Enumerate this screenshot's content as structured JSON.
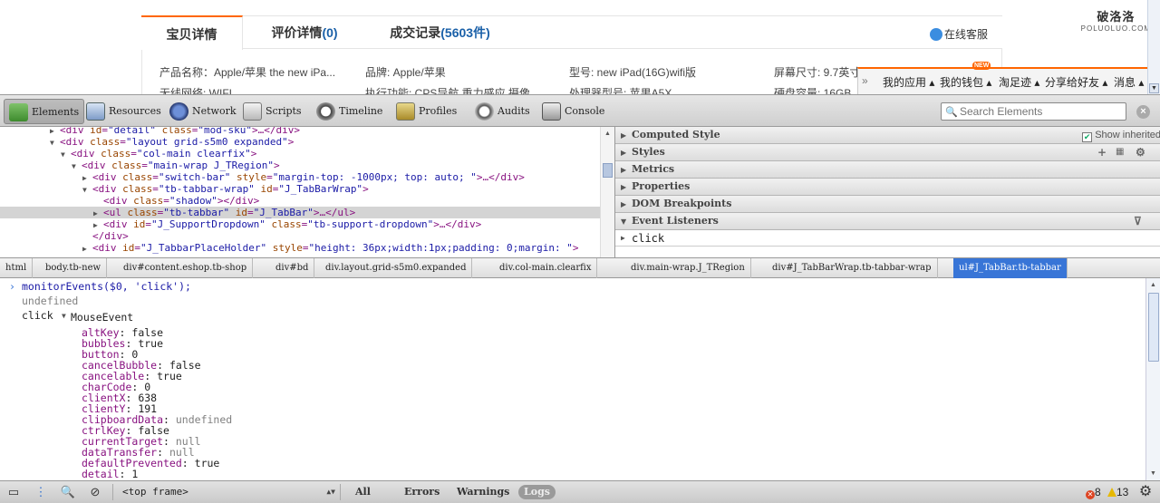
{
  "page": {
    "tabs": [
      {
        "label": "宝贝详情",
        "count": ""
      },
      {
        "label": "评价详情",
        "count": "(0)"
      },
      {
        "label": "成交记录",
        "count": "(5603件)"
      }
    ],
    "service": "在线客服",
    "attrs_row1": [
      "产品名称：Apple/苹果 the new iPa...",
      "品牌: Apple/苹果",
      "型号: new iPad(16G)wifi版",
      "屏幕尺寸: 9.7英寸"
    ],
    "attrs_row2": [
      "无线网络: WIFI",
      "执行功能: CPS导航 重力感应 摄像",
      "处理器型号: 苹果A5X",
      "硬盘容量: 16GB"
    ],
    "logo": {
      "line1": "破洛洛",
      "line2": "POLUOLUO.COM"
    },
    "toolbar_float": [
      "我的应用",
      "我的钱包",
      "淘足迹",
      "分享给好友",
      "消息"
    ],
    "new_badge": "NEW"
  },
  "devtools": {
    "toolbar": [
      "Elements",
      "Resources",
      "Network",
      "Scripts",
      "Timeline",
      "Profiles",
      "Audits",
      "Console"
    ],
    "search_placeholder": "Search Elements",
    "dom_lines": [
      {
        "depth": 4,
        "tri": "▶",
        "html": "<div id=\"detail\" class=\"mod-sku\">…</div>"
      },
      {
        "depth": 4,
        "tri": "▼",
        "html": "<div class=\"layout grid-s5m0  expanded\">"
      },
      {
        "depth": 5,
        "tri": "▼",
        "html": "<div class=\"col-main clearfix\">"
      },
      {
        "depth": 6,
        "tri": "▼",
        "html": "<div class=\"main-wrap J_TRegion\">"
      },
      {
        "depth": 7,
        "tri": "▶",
        "html": "<div class=\"switch-bar\" style=\"margin-top: -1000px; top: auto; \">…</div>"
      },
      {
        "depth": 7,
        "tri": "▼",
        "html": "<div class=\"tb-tabbar-wrap\" id=\"J_TabBarWrap\">"
      },
      {
        "depth": 8,
        "tri": "",
        "html": "<div class=\"shadow\"></div>"
      },
      {
        "depth": 8,
        "tri": "▶",
        "html": "<ul class=\"tb-tabbar\" id=\"J_TabBar\">…</ul>",
        "selected": true
      },
      {
        "depth": 8,
        "tri": "▶",
        "html": "<div id=\"J_SupportDropdown\" class=\"tb-support-dropdown\">…</div>"
      },
      {
        "depth": 7,
        "tri": "",
        "html": "</div>"
      },
      {
        "depth": 7,
        "tri": "▶",
        "html": "<div id=\"J_TabbarPlaceHolder\" style=\"height: 36px;width:1px;padding: 0;margin: \">"
      }
    ],
    "sidebar": {
      "panes": [
        "Computed Style",
        "Styles",
        "Metrics",
        "Properties",
        "DOM Breakpoints",
        "Event Listeners"
      ],
      "show_inherited": "Show inherited",
      "listener": "click"
    },
    "breadcrumbs": [
      "html",
      "body.tb-new",
      "div#content.eshop.tb-shop",
      "div#bd",
      "div.layout.grid-s5m0.expanded",
      "div.col-main.clearfix",
      "div.main-wrap.J_TRegion",
      "div#J_TabBarWrap.tb-tabbar-wrap",
      "ul#J_TabBar.tb-tabbar"
    ],
    "console": {
      "command": "monitorEvents($0, 'click');",
      "result": "undefined",
      "event_label": "click",
      "event_type": "MouseEvent",
      "props": [
        {
          "k": "altKey",
          "v": "false",
          "grey": false
        },
        {
          "k": "bubbles",
          "v": "true",
          "grey": false
        },
        {
          "k": "button",
          "v": "0",
          "grey": false
        },
        {
          "k": "cancelBubble",
          "v": "false",
          "grey": false
        },
        {
          "k": "cancelable",
          "v": "true",
          "grey": false
        },
        {
          "k": "charCode",
          "v": "0",
          "grey": false
        },
        {
          "k": "clientX",
          "v": "638",
          "grey": false
        },
        {
          "k": "clientY",
          "v": "191",
          "grey": false
        },
        {
          "k": "clipboardData",
          "v": "undefined",
          "grey": true
        },
        {
          "k": "ctrlKey",
          "v": "false",
          "grey": false
        },
        {
          "k": "currentTarget",
          "v": "null",
          "grey": true
        },
        {
          "k": "dataTransfer",
          "v": "null",
          "grey": true
        },
        {
          "k": "defaultPrevented",
          "v": "true",
          "grey": false
        },
        {
          "k": "detail",
          "v": "1",
          "grey": false
        }
      ]
    },
    "statusbar": {
      "frame": "<top frame>",
      "filters": [
        "All",
        "Errors",
        "Warnings",
        "Logs"
      ],
      "errors": "8",
      "warnings": "13"
    },
    "colors": {
      "selected_crumb": "#3875d7",
      "tag": "#881280",
      "attr_name": "#994500",
      "attr_value": "#1a1aa6"
    }
  }
}
